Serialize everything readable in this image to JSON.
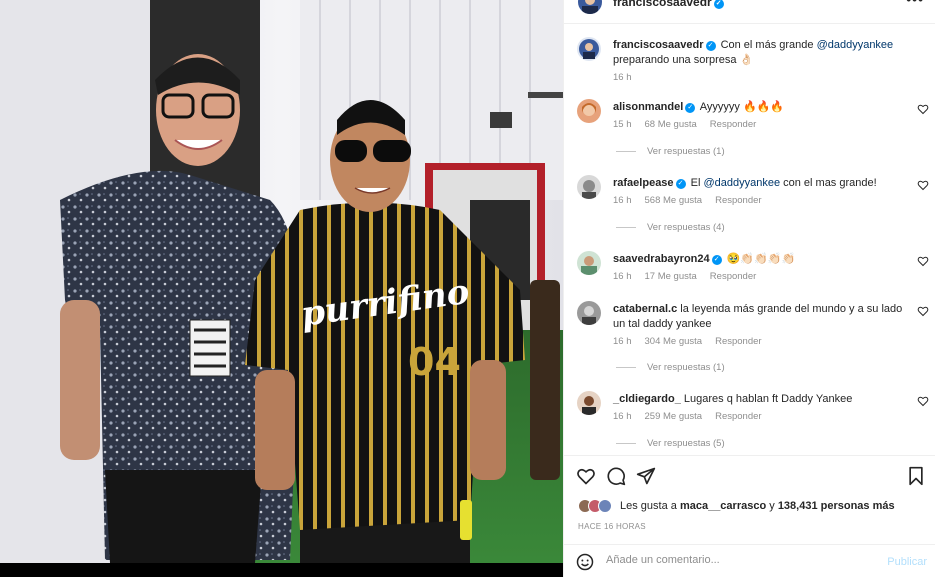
{
  "post": {
    "username": "franciscosaavedr",
    "more_icon": "more-horizontal-icon"
  },
  "caption": {
    "username": "franciscosaavedr",
    "text_before": "Con el más grande ",
    "mention": "@daddyyankee",
    "text_after": " preparando una sorpresa 👌🏻",
    "time": "16 h"
  },
  "comments": [
    {
      "username": "alisonmandel",
      "verified": true,
      "text": "Ayyyyyy 🔥🔥🔥",
      "time": "15 h",
      "likes": "68 Me gusta",
      "reply": "Responder",
      "replies": "Ver respuestas (1)",
      "avatar_color": "#e7a27b"
    },
    {
      "username": "rafaelpease",
      "verified": true,
      "text_before": "El ",
      "mention": "@daddyyankee",
      "text_after": " con el mas grande!",
      "time": "16 h",
      "likes": "568 Me gusta",
      "reply": "Responder",
      "replies": "Ver respuestas (4)",
      "avatar_color": "#8a8a8a"
    },
    {
      "username": "saavedrabayron24",
      "verified": true,
      "text": "🥹👏🏻👏🏻👏🏻👏🏻",
      "time": "16 h",
      "likes": "17 Me gusta",
      "reply": "Responder",
      "avatar_color": "#5c8f6e"
    },
    {
      "username": "catabernal.c",
      "verified": false,
      "text": "la leyenda más grande del mundo y a su lado un tal daddy yankee",
      "time": "16 h",
      "likes": "304 Me gusta",
      "reply": "Responder",
      "replies": "Ver respuestas (1)",
      "avatar_color": "#6b6b6b"
    },
    {
      "username": "_cldiegardo_",
      "verified": false,
      "text": "Lugares q hablan ft Daddy Yankee",
      "time": "16 h",
      "likes": "259 Me gusta",
      "reply": "Responder",
      "replies": "Ver respuestas (5)",
      "avatar_color": "#7a4a2e"
    }
  ],
  "actions": {
    "like_icon": "heart-icon",
    "comment_icon": "comment-icon",
    "share_icon": "send-icon",
    "save_icon": "bookmark-icon"
  },
  "likes": {
    "text_before": "Les gusta a ",
    "user": "maca__carrasco",
    "text_middle": " y ",
    "count": "138,431 personas más"
  },
  "time_ago": "HACE 16 HORAS",
  "add_comment": {
    "placeholder": "Añade un comentario...",
    "publish": "Publicar"
  },
  "photo": {
    "jersey_text": "purrifino",
    "jersey_number": "04"
  },
  "colors": {
    "verified": "#0095f6",
    "mention": "#00376b",
    "secondary_text": "#8e8e8e",
    "publish_disabled": "#b2dffc"
  }
}
